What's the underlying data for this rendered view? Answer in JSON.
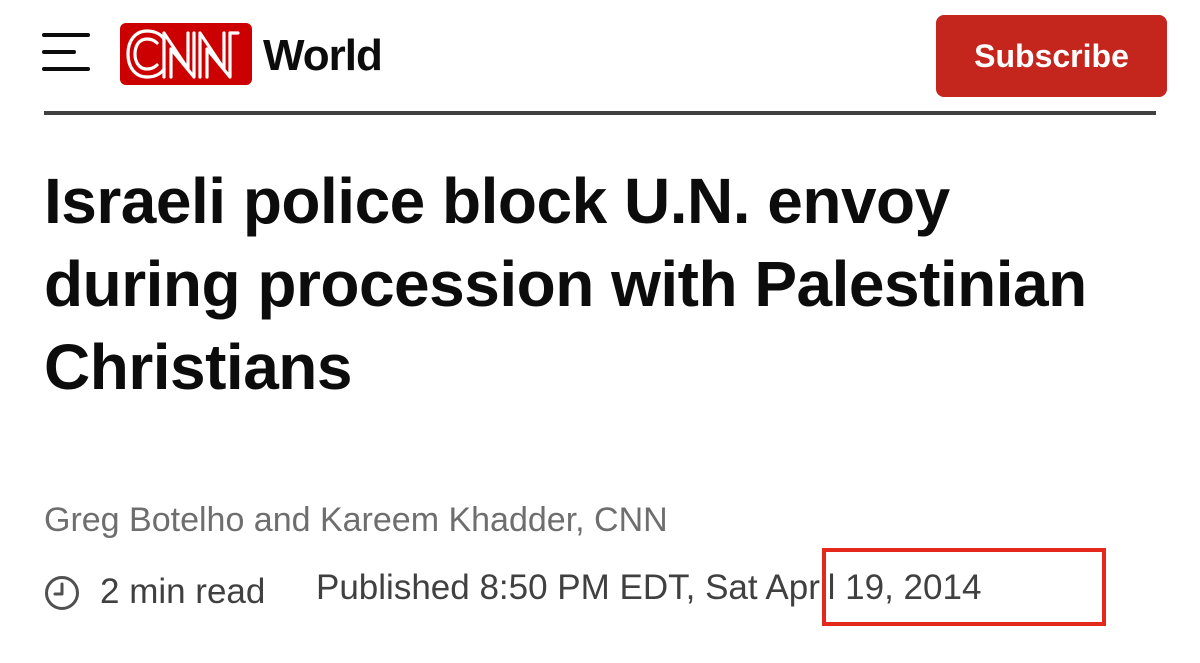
{
  "header": {
    "menu_icon": "hamburger-menu-icon",
    "logo_text": "CNN",
    "section": "World",
    "subscribe_label": "Subscribe"
  },
  "colors": {
    "brand_red": "#cc0000",
    "subscribe_bg": "#c4261d",
    "annotation_red": "#e5281c",
    "text_dark": "#0c0c0c",
    "text_muted": "#6e6e6e"
  },
  "article": {
    "headline": "Israeli police block U.N. envoy during procession with Palestinian Christians",
    "byline": "Greg Botelho and Kareem Khadder, CNN",
    "read_time": "2 min read",
    "published_prefix": "Published 8:50 PM EDT, Sat ",
    "published_date": "April 19, 2014",
    "clock_icon": "clock-icon"
  }
}
